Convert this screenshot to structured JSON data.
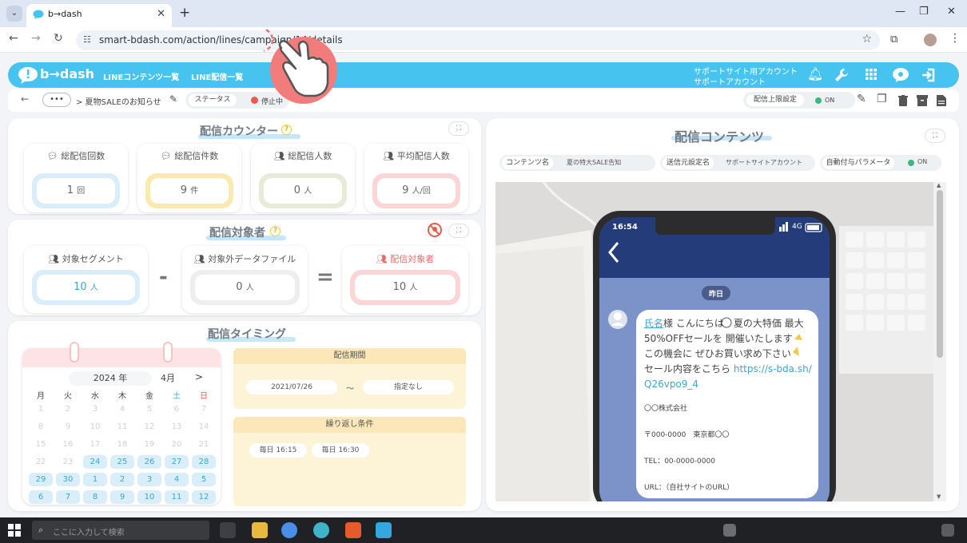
{
  "browser": {
    "tab_title": "b→dash",
    "new_tab": "+",
    "url": "smart-bdash.com/action/lines/campaign/14/details",
    "menu_glyph": "⌄",
    "close_glyph": "✕",
    "back_glyph": "←",
    "forward_glyph": "→",
    "reload_glyph": "↻",
    "minimize_glyph": "—",
    "maximize_glyph": "❐",
    "window_close_glyph": "✕"
  },
  "header": {
    "logo_text": "b→dash",
    "nav": [
      "LINEコンテンツ一覧",
      "LINE配信一覧"
    ],
    "account_line1": "サポートサイト用アカウント",
    "account_line2": "サポートアカウント",
    "brand_color": "#46c3ee"
  },
  "subbar": {
    "dots": "•••",
    "breadcrumb": "> 夏物SALEのお知らせ",
    "status_label": "ステータス",
    "status_value": "停止中",
    "limit_label": "配信上限設定",
    "limit_value": "ON"
  },
  "counter": {
    "title": "配信カウンター",
    "stats": [
      {
        "label": "総配信回数",
        "value": "1",
        "unit": "回",
        "icon": "line-icon"
      },
      {
        "label": "総配信件数",
        "value": "9",
        "unit": "件",
        "icon": "line-icon"
      },
      {
        "label": "総配信人数",
        "value": "0",
        "unit": "人",
        "icon": "users-icon"
      },
      {
        "label": "平均配信人数",
        "value": "9",
        "unit": "人/回",
        "icon": "users-icon"
      }
    ]
  },
  "targets": {
    "title": "配信対象者",
    "segment_label": "対象セグメント",
    "segment_value": "10",
    "exclude_label": "対象外データファイル",
    "exclude_value": "0",
    "result_label": "配信対象者",
    "result_value": "10",
    "unit": "人",
    "minus": "-",
    "equals": "="
  },
  "timing": {
    "title": "配信タイミング",
    "year": "2024 年",
    "month": "4月",
    "next": ">",
    "weekdays": [
      "月",
      "火",
      "水",
      "木",
      "金",
      "土",
      "日"
    ],
    "days_dim": [
      "1",
      "2",
      "3",
      "4",
      "5",
      "6",
      "7",
      "8",
      "9",
      "10",
      "11",
      "12",
      "13",
      "14",
      "15",
      "16",
      "17",
      "18",
      "19",
      "20",
      "21",
      "22",
      "23"
    ],
    "days_active": [
      "24",
      "25",
      "26",
      "27",
      "28",
      "29",
      "30",
      "1",
      "2",
      "3",
      "4",
      "5",
      "6",
      "7",
      "8",
      "9",
      "10",
      "11",
      "12"
    ],
    "period_title": "配信期間",
    "period_start": "2021/07/26",
    "period_sep": "～",
    "period_end": "指定なし",
    "repeat_title": "繰り返し条件",
    "repeat_items": [
      "毎日 16:15",
      "毎日 16:30"
    ]
  },
  "content": {
    "title": "配信コンテンツ",
    "info": [
      {
        "key": "コンテンツ名",
        "value": "夏の特大SALE告知"
      },
      {
        "key": "送信元設定名",
        "value": "サポートサイトアカウント"
      },
      {
        "key": "自動付与パラメータ",
        "value": "ON"
      }
    ],
    "phone": {
      "time": "16:54",
      "signal": "4G",
      "date_badge": "昨日",
      "name_link": "氏名",
      "line1_rest": "様 こんにちは",
      "line1_tail": "夏の大特価 最大",
      "line2": "50%OFFセールを 開催いたします",
      "line3": "この機会に ぜひお買い求め下さい",
      "line4": "セール内容をこちら",
      "link_part1": "https://s-bda.sh/",
      "link_part2": "Q26vpo9_4",
      "company": "〇〇株式会社",
      "address": "〒000-0000　東京都〇〇",
      "tel": "TEL：00-0000-0000",
      "url": "URL：（自社サイトのURL）"
    }
  },
  "taskbar": {
    "search_placeholder": "ここに入力して検索"
  }
}
